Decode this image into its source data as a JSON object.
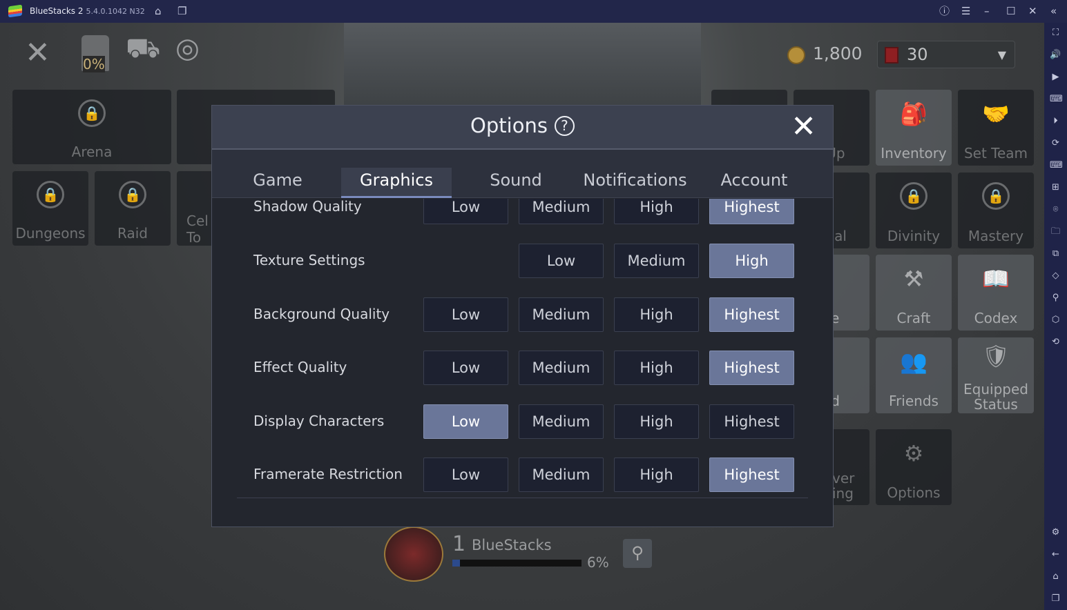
{
  "titlebar": {
    "app_name": "BlueStacks 2",
    "version": "5.4.0.1042 N32"
  },
  "sidebar_icons": [
    "fullscreen-icon",
    "volume-icon",
    "media-icon",
    "keyboard-icon",
    "macro-icon",
    "rotate-icon",
    "controls-icon",
    "apk-icon",
    "screenshot-icon",
    "folder-icon",
    "multi-instance-icon",
    "eco-icon",
    "location-icon",
    "layers-icon",
    "sync-icon",
    "settings-icon",
    "back-icon",
    "home-icon",
    "recents-icon"
  ],
  "hud": {
    "chest_percent": "0%",
    "gold": "1,800",
    "energy": "30"
  },
  "left_tiles": [
    {
      "label": "Arena"
    },
    {
      "label": "Dungeons"
    },
    {
      "label": "Raid"
    },
    {
      "label": "Cel To"
    }
  ],
  "right_tiles": {
    "level_up": "l Up",
    "inventory": "Inventory",
    "set_team": "Set Team",
    "potential": "ntial",
    "divinity": "Divinity",
    "mastery": "Mastery",
    "house": "se",
    "craft": "Craft",
    "codex": "Codex",
    "guild": "ild",
    "friends": "Friends",
    "equipped_status": "Equipped Status",
    "server_ranking": "ver ing",
    "options": "Options"
  },
  "profile": {
    "level": "1",
    "name": "BlueStacks",
    "exp_percent": "6%",
    "exp_fraction": 0.06
  },
  "dialog": {
    "title": "Options",
    "help": "?",
    "tabs": [
      "Game",
      "Graphics",
      "Sound",
      "Notifications",
      "Account"
    ],
    "active_tab": "Graphics",
    "rows": [
      {
        "label": "Shadow Quality",
        "options": [
          "Low",
          "Medium",
          "High",
          "Highest"
        ],
        "selected": "Highest"
      },
      {
        "label": "Texture Settings",
        "options": [
          "Low",
          "Medium",
          "High"
        ],
        "selected": "High"
      },
      {
        "label": "Background Quality",
        "options": [
          "Low",
          "Medium",
          "High",
          "Highest"
        ],
        "selected": "Highest"
      },
      {
        "label": "Effect Quality",
        "options": [
          "Low",
          "Medium",
          "High",
          "Highest"
        ],
        "selected": "Highest"
      },
      {
        "label": "Display Characters",
        "options": [
          "Low",
          "Medium",
          "High",
          "Highest"
        ],
        "selected": "Low"
      },
      {
        "label": "Framerate Restriction",
        "options": [
          "Low",
          "Medium",
          "High",
          "Highest"
        ],
        "selected": "Highest"
      }
    ]
  }
}
